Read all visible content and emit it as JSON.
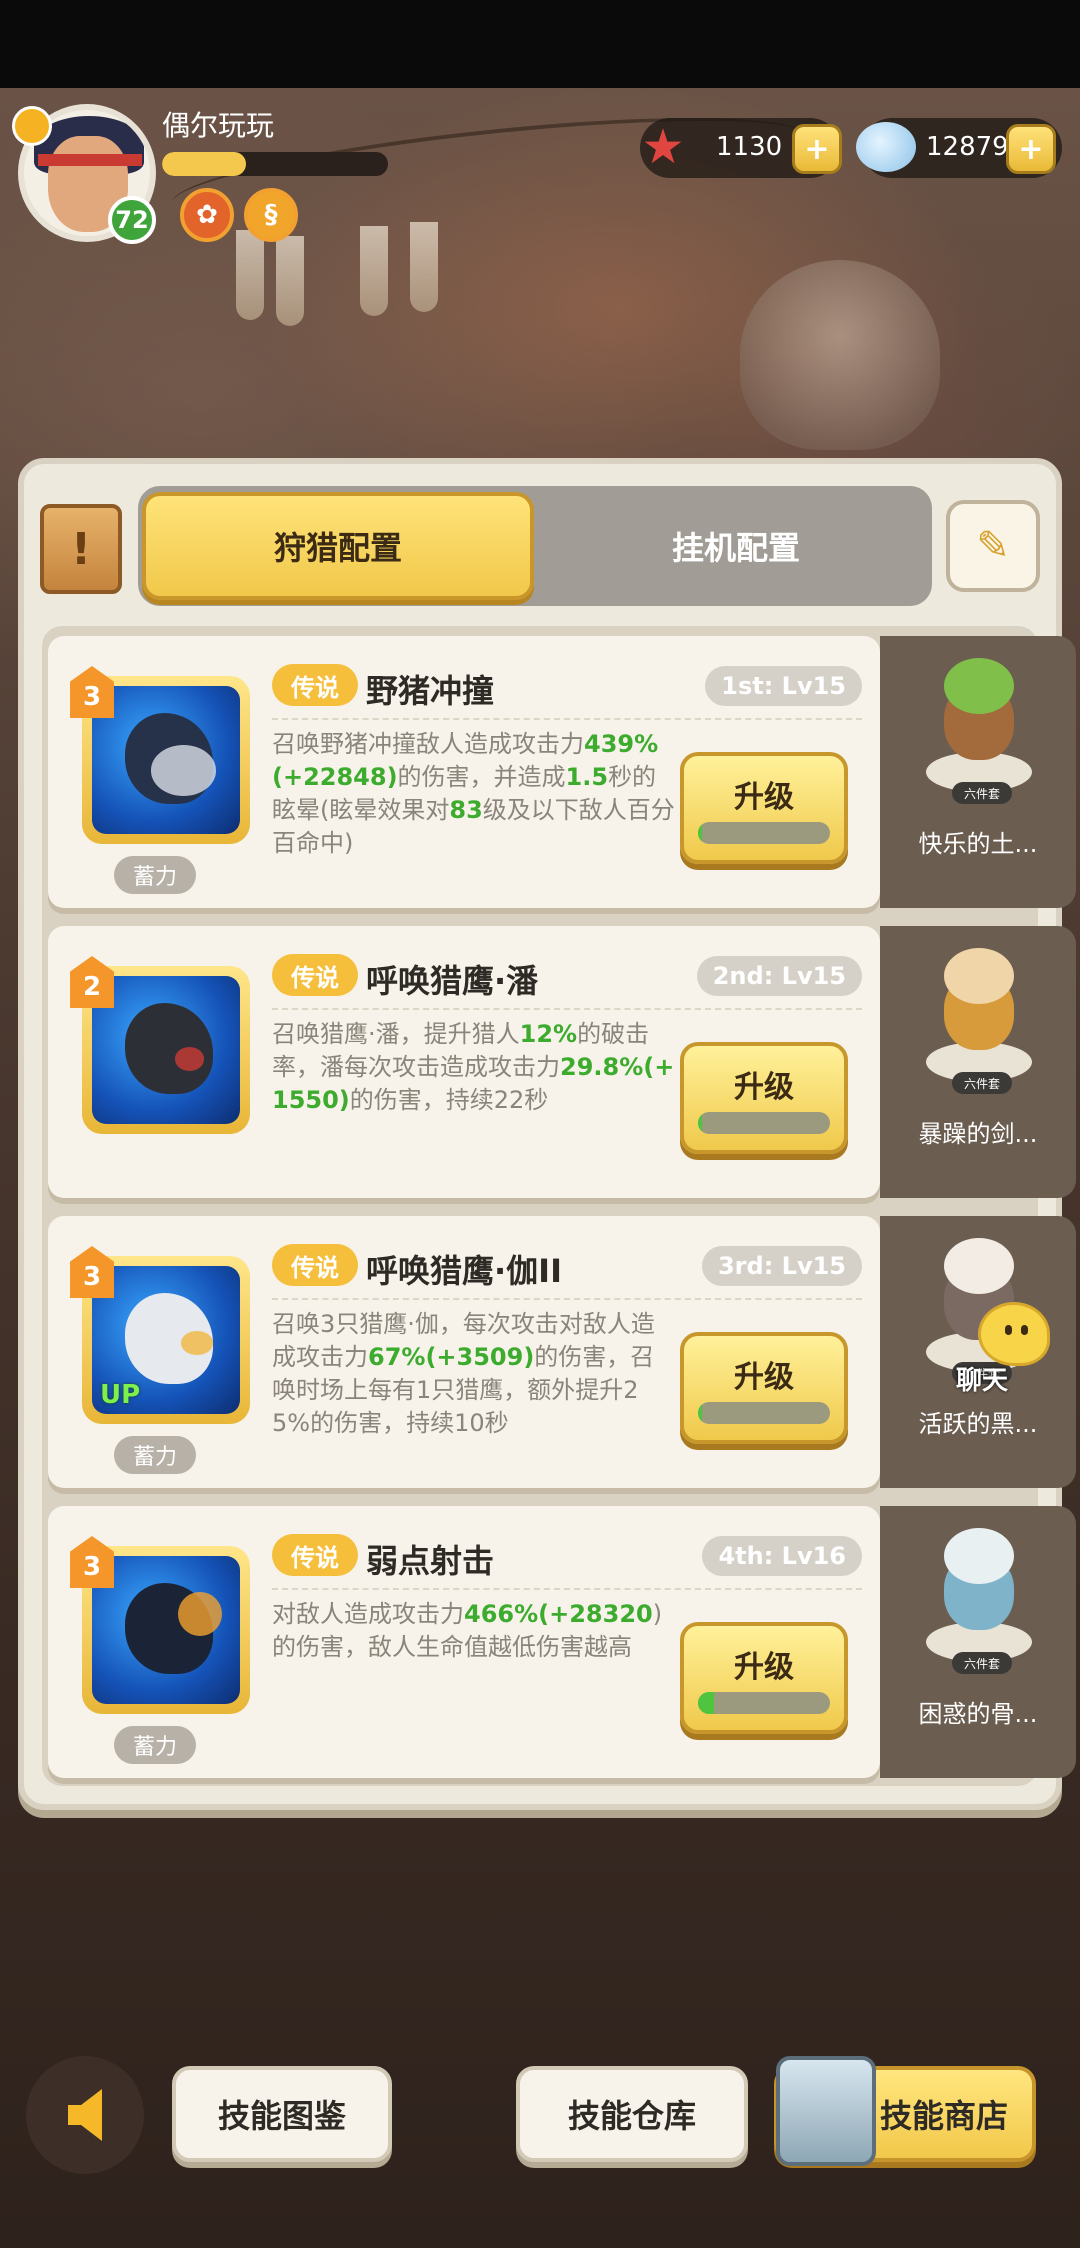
{
  "player": {
    "name": "偶尔玩玩",
    "level": "72",
    "exp_fraction": 0.37
  },
  "currency": {
    "starfish": "1130",
    "shells": "12879"
  },
  "tabs": [
    {
      "label": "狩猎配置",
      "active": true
    },
    {
      "label": "挂机配置",
      "active": false
    }
  ],
  "skills": [
    {
      "stars": "3",
      "rarity": "传说",
      "name": "野猪冲撞",
      "slot": "1st: Lv15",
      "desc_parts": [
        "召唤野猪冲撞敌人造成攻击力",
        "439%(+22848)",
        "的伤害，并造成",
        "1.5",
        "秒的眩晕(眩晕效果对",
        "83",
        "级及以下敌人百分百命中)"
      ],
      "charge": "蓄力",
      "up": "",
      "upgrade": "升级",
      "progress": 0.03,
      "pet_name": "快乐的土...",
      "pet_tag": "六件套"
    },
    {
      "stars": "2",
      "rarity": "传说",
      "name": "呼唤猎鹰·潘",
      "slot": "2nd: Lv15",
      "desc_parts": [
        "召唤猎鹰·潘，提升猎人",
        "12%",
        "的破击率，潘每次攻击造成攻击力",
        "29.8%(+1550)",
        "的伤害，持续22秒"
      ],
      "charge": "",
      "up": "",
      "upgrade": "升级",
      "progress": 0.03,
      "pet_name": "暴躁的剑...",
      "pet_tag": "六件套"
    },
    {
      "stars": "3",
      "rarity": "传说",
      "name": "呼唤猎鹰·伽II",
      "slot": "3rd: Lv15",
      "desc_parts": [
        "召唤3只猎鹰·伽，每次攻击对敌人造成攻击力",
        "67%(+3509)",
        "的伤害，召唤时场上每有1只猎鹰，额外提升25%的伤害，持续10秒"
      ],
      "charge": "蓄力",
      "up": "UP",
      "upgrade": "升级",
      "progress": 0.03,
      "pet_name": "活跃的黑...",
      "pet_tag": "六件套"
    },
    {
      "stars": "3",
      "rarity": "传说",
      "name": "弱点射击",
      "slot": "4th: Lv16",
      "desc_parts": [
        "对敌人造成攻击力",
        "466%(+28320",
        ")的伤害，敌人生命值越低伤害越高"
      ],
      "charge": "蓄力",
      "up": "",
      "upgrade": "升级",
      "progress": 0.12,
      "pet_name": "困惑的骨...",
      "pet_tag": "六件套"
    }
  ],
  "chat": {
    "label": "聊天"
  },
  "bottom": {
    "catalog": "技能图鉴",
    "storage": "技能仓库",
    "shop": "技能商店"
  },
  "colors": {
    "accent_gold": "#f1c84a",
    "green_value": "#3cab2e",
    "rarity_orange": "#f6bf3b"
  }
}
